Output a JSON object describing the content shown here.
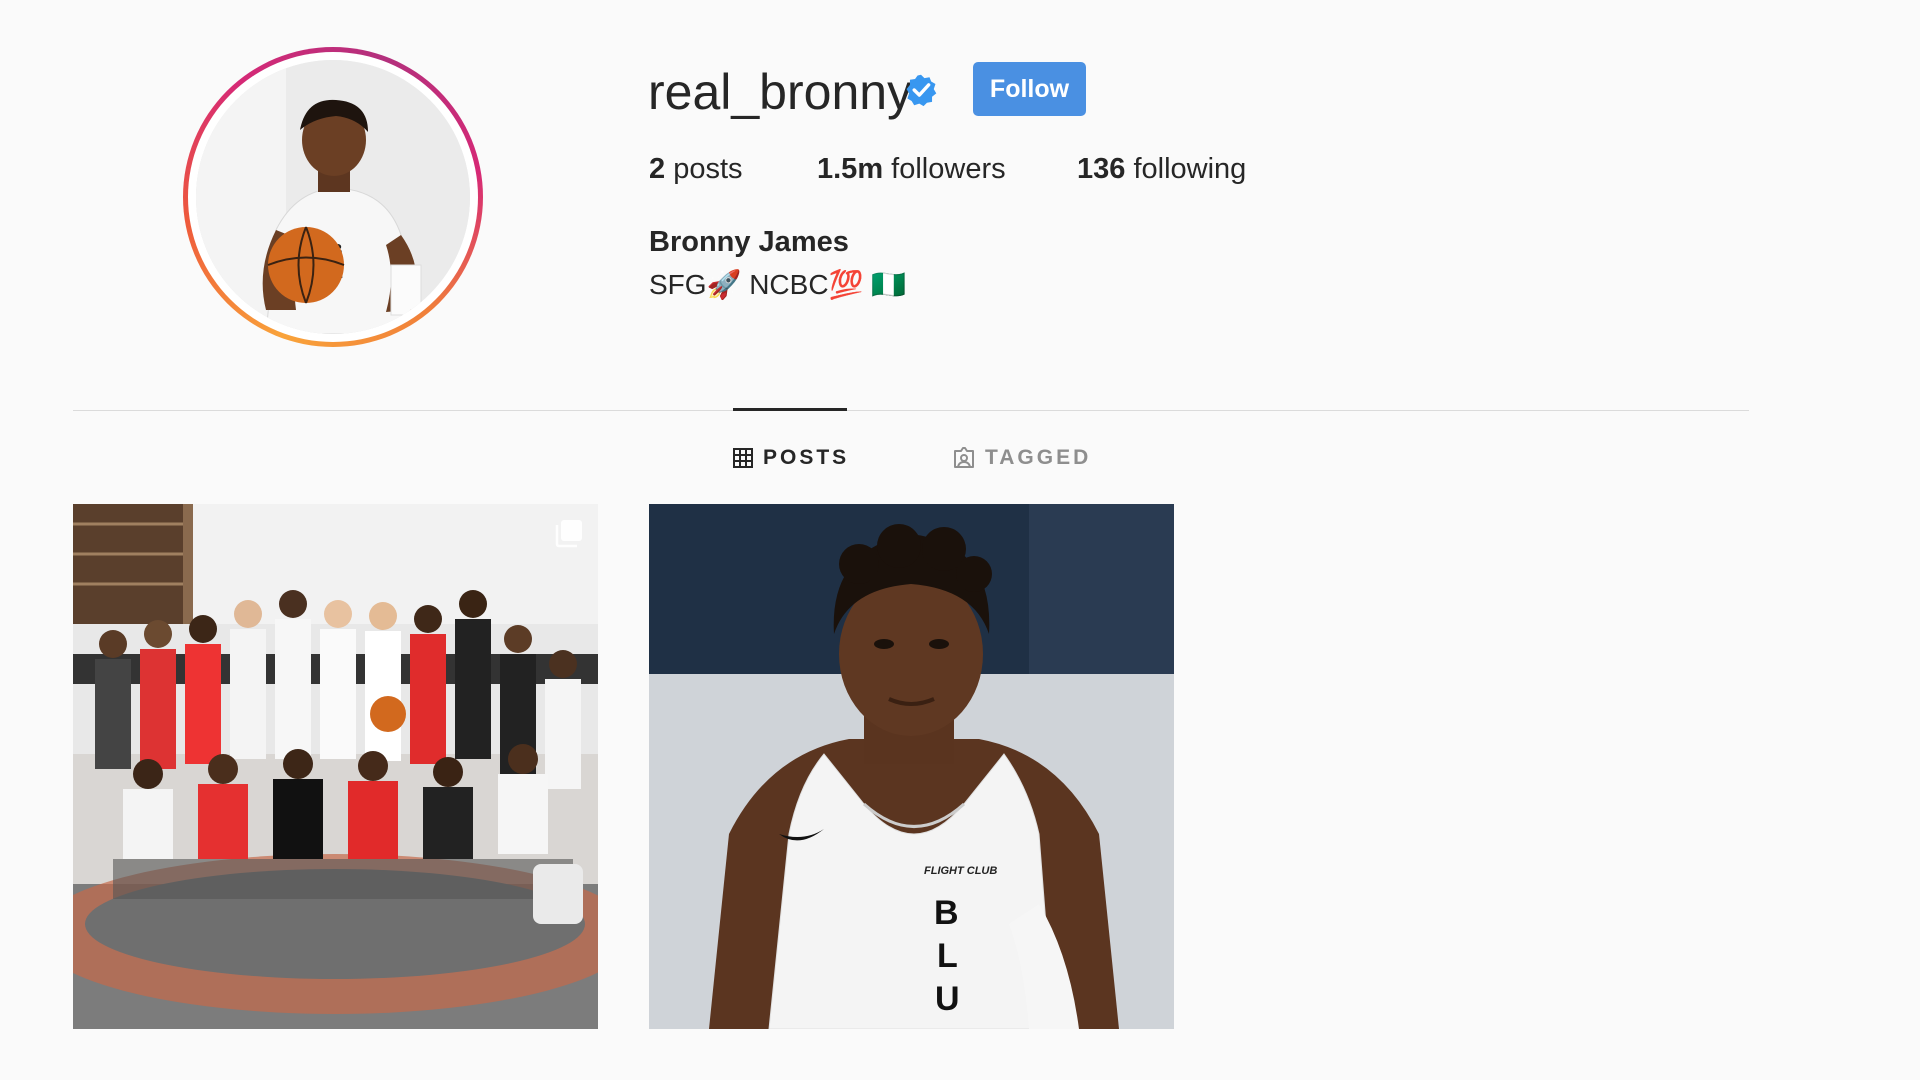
{
  "profile": {
    "username": "real_bronny",
    "verified": true,
    "follow_label": "Follow",
    "stats": {
      "posts_count": "2",
      "posts_label": "posts",
      "followers_count": "1.5m",
      "followers_label": "followers",
      "following_count": "136",
      "following_label": "following"
    },
    "full_name": "Bronny James",
    "bio": "SFG🚀 NCBC💯 🇳🇬"
  },
  "tabs": [
    {
      "label": "POSTS",
      "icon": "grid-icon",
      "active": true
    },
    {
      "label": "TAGGED",
      "icon": "tagged-icon",
      "active": false
    }
  ],
  "posts": [
    {
      "type": "carousel",
      "icon": "multiple-photos-icon"
    },
    {
      "type": "photo"
    }
  ],
  "colors": {
    "follow_button": "#4a90e2",
    "verified_badge": "#3897f0",
    "background": "#fafafa",
    "divider": "#dbdbdb"
  }
}
